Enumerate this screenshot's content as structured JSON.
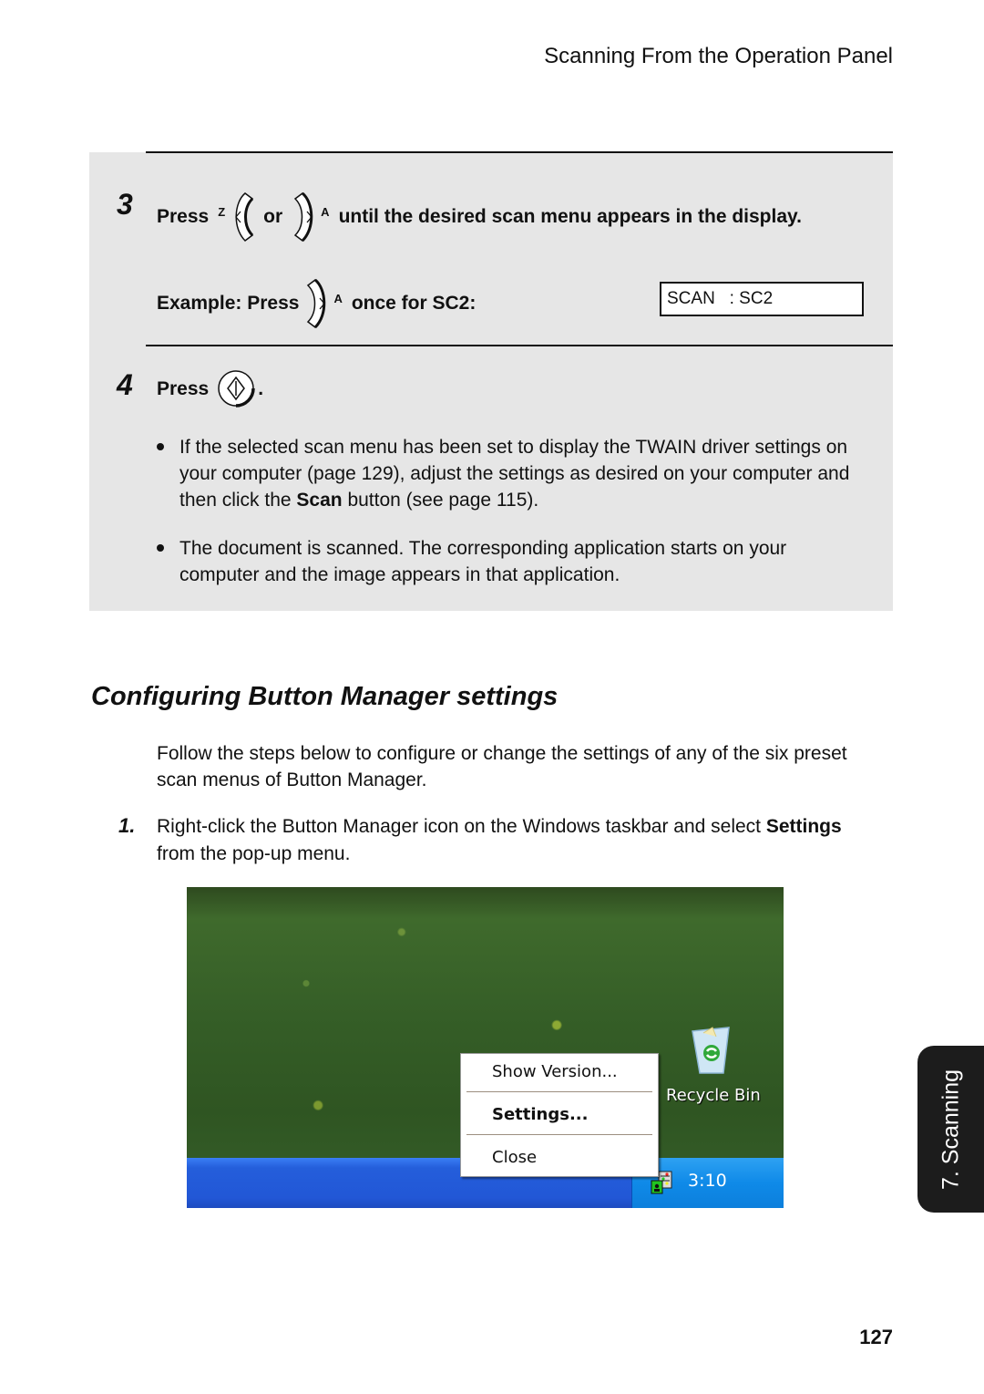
{
  "header": {
    "title": "Scanning From the Operation Panel"
  },
  "steps": [
    {
      "number": "3",
      "press_label": "Press",
      "left_key_label": "Z",
      "or_label": "or",
      "right_key_label": "A",
      "instruction": "until the desired scan menu appears in the display.",
      "example_label": "Example: Press",
      "example_key_label": "A",
      "example_suffix": "once for SC2:",
      "display": {
        "text": "SCAN   : SC2"
      }
    },
    {
      "number": "4",
      "press_label": "Press",
      "suffix": ".",
      "bullets": [
        {
          "pre": "If the selected scan menu has been set to display the TWAIN driver settings on your computer (page 129), adjust the settings as desired on your computer and then click the ",
          "bold": "Scan",
          "post": " button (see page 115)."
        },
        {
          "pre": "The document is scanned. The corresponding application starts on your computer and the image appears in that application.",
          "bold": "",
          "post": ""
        }
      ]
    }
  ],
  "section": {
    "title": "Configuring Button Manager settings",
    "intro": "Follow the steps below to configure or change the settings of any of the six preset scan menus of Button Manager.",
    "items": [
      {
        "number": "1.",
        "pre": "Right-click the Button Manager icon on the Windows taskbar and select ",
        "bold": "Settings",
        "post": " from the pop-up menu."
      }
    ]
  },
  "screenshot": {
    "context_menu": {
      "items": [
        {
          "label": "Show Version...",
          "bold": false
        },
        {
          "label": "Settings...",
          "bold": true
        },
        {
          "label": "Close",
          "bold": false
        }
      ]
    },
    "desktop_icon": {
      "label": "Recycle Bin",
      "icon": "recycle-bin-icon"
    },
    "taskbar": {
      "clock": "3:10",
      "tray_icon": "button-manager-icon"
    }
  },
  "side_tab": {
    "label": "7. Scanning"
  },
  "footer": {
    "page_number": "127"
  }
}
